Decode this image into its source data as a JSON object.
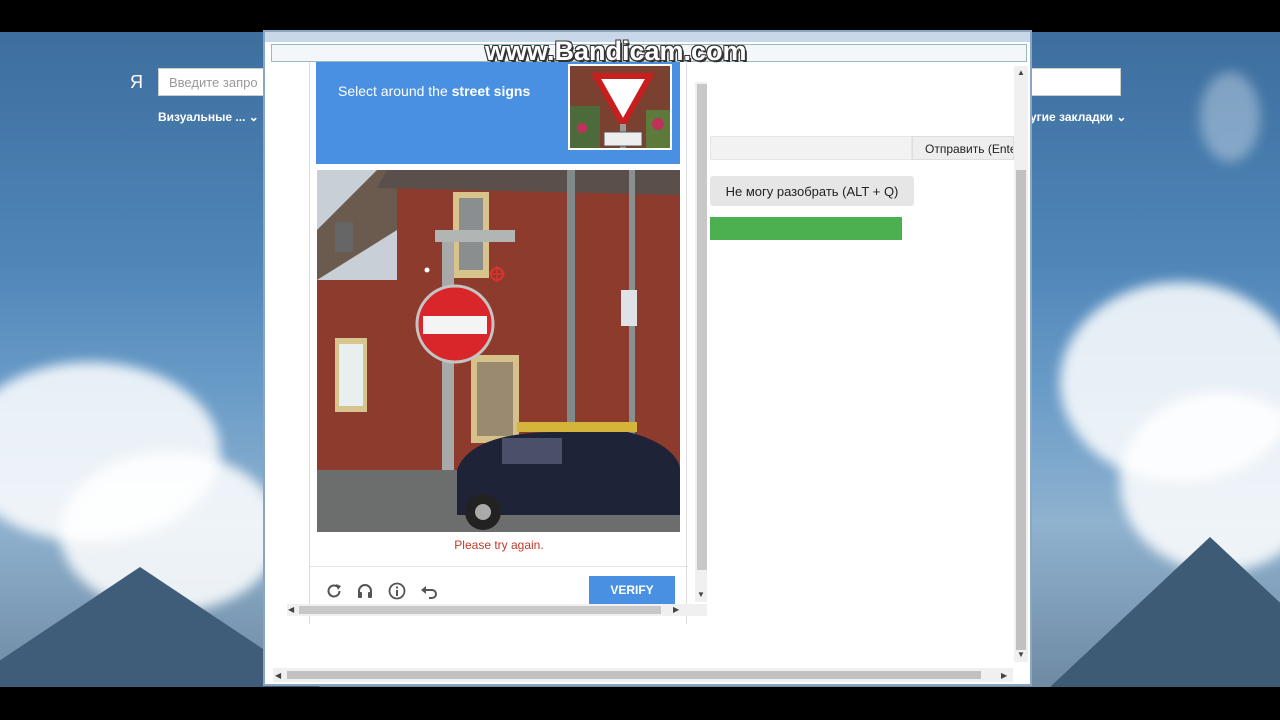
{
  "watermark": "www.Bandicam.com",
  "background": {
    "logo": "Я",
    "search_placeholder": "Введите запро",
    "bookmark_visual": "Визуальные ...",
    "bookmark_other": "угие закладки"
  },
  "captcha": {
    "instruction_prefix": "Select around the ",
    "instruction_bold": "street signs",
    "error_text": "Please try again.",
    "verify_label": "VERIFY",
    "icons": [
      "reload-icon",
      "headphones-icon",
      "info-icon",
      "undo-icon"
    ]
  },
  "panel": {
    "send_label": "Отправить (Enter",
    "cant_read_label": "Не могу разобрать (ALT + Q)",
    "progress": 1.0,
    "progress_color": "#4caf50"
  },
  "colors": {
    "accent": "#4a90e2",
    "error": "#c0392b"
  }
}
